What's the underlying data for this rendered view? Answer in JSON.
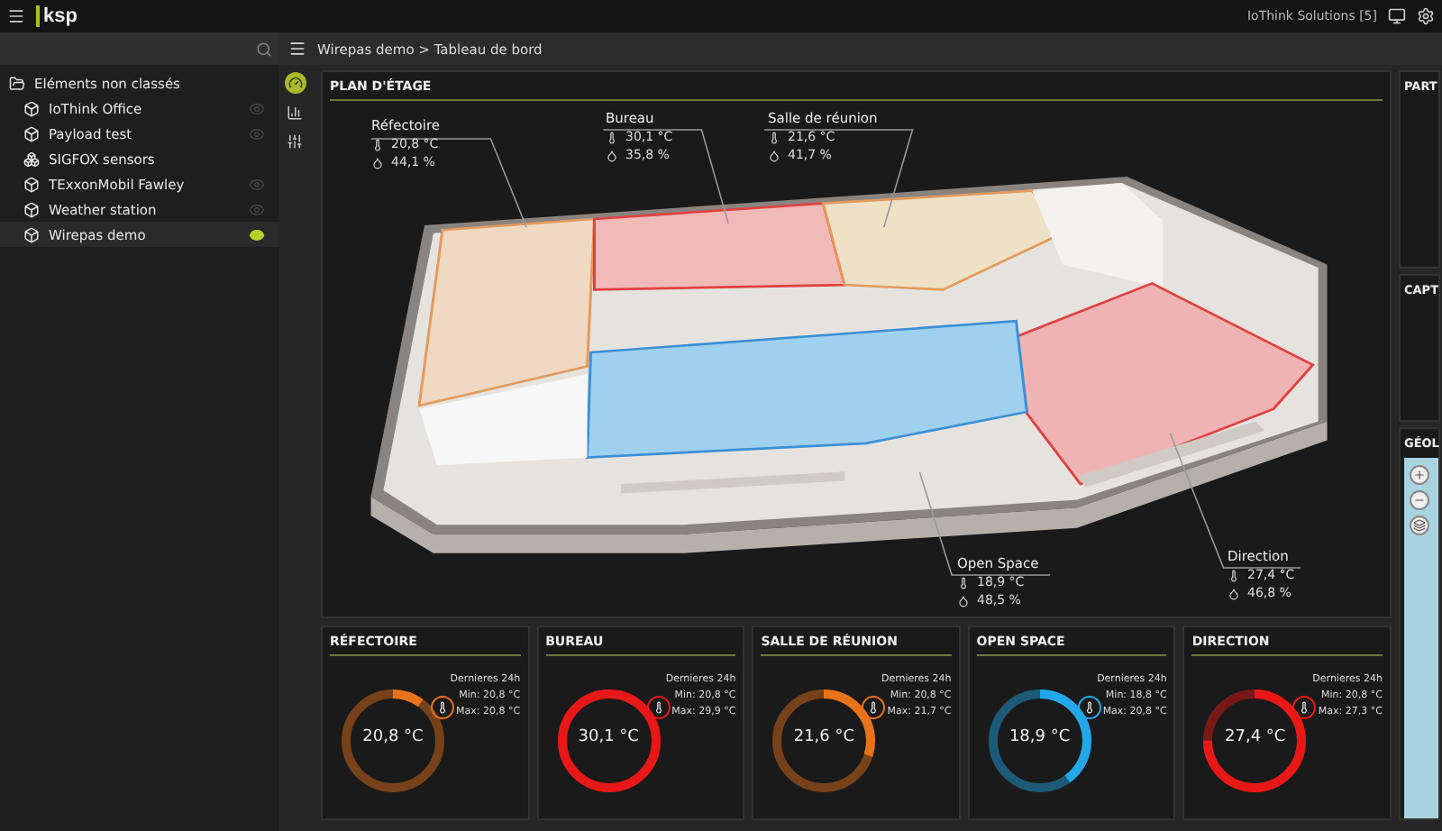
{
  "topbar": {
    "logo": "ksp",
    "account": "IoThink Solutions [5]"
  },
  "sidebar": {
    "tree": [
      {
        "label": "Eléments non classés",
        "kind": "folder",
        "children": [
          {
            "label": "IoThink Office",
            "kind": "device",
            "selected": false
          },
          {
            "label": "Payload test",
            "kind": "device",
            "selected": false
          },
          {
            "label": "SIGFOX sensors",
            "kind": "group",
            "selected": false
          },
          {
            "label": "TExxonMobil Fawley",
            "kind": "device",
            "selected": false
          },
          {
            "label": "Weather station",
            "kind": "device",
            "selected": false
          },
          {
            "label": "Wirepas demo",
            "kind": "device",
            "selected": true
          }
        ]
      }
    ]
  },
  "tools": [
    {
      "kind": "dashboard",
      "selected": true
    },
    {
      "kind": "chart",
      "selected": false
    },
    {
      "kind": "settings",
      "selected": false
    }
  ],
  "breadcrumb": "Wirepas demo > Tableau de bord",
  "floor_plan": {
    "title": "PLAN D'ÉTAGE",
    "rooms": [
      {
        "name": "Réfectoire",
        "temperature": "20,8 °C",
        "humidity": "44,1 %"
      },
      {
        "name": "Bureau",
        "temperature": "30,1 °C",
        "humidity": "35,8 %"
      },
      {
        "name": "Salle de réunion",
        "temperature": "21,6 °C",
        "humidity": "41,7 %"
      },
      {
        "name": "Open Space",
        "temperature": "18,9 °C",
        "humidity": "48,5 %"
      },
      {
        "name": "Direction",
        "temperature": "27,4 °C",
        "humidity": "46,8 %"
      }
    ]
  },
  "gauges": [
    {
      "title": "RÉFECTOIRE",
      "value": "20,8 °C",
      "level": 0.1,
      "color": "#e8731a",
      "period": "Dernieres 24h",
      "min": "Min: 20,8 °C",
      "max": "Max: 20,8 °C"
    },
    {
      "title": "BUREAU",
      "value": "30,1 °C",
      "level": 1,
      "color": "#e81818",
      "period": "Dernieres 24h",
      "min": "Min: 20,8 °C",
      "max": "Max: 29,9 °C"
    },
    {
      "title": "SALLE DE RÉUNION",
      "value": "21,6 °C",
      "level": 0.3,
      "color": "#e8731a",
      "period": "Dernieres 24h",
      "min": "Min: 20,8 °C",
      "max": "Max: 21,7 °C"
    },
    {
      "title": "OPEN SPACE",
      "value": "18,9 °C",
      "level": 0.4,
      "color": "#22a8e8",
      "period": "Dernieres 24h",
      "min": "Min: 18,8 °C",
      "max": "Max: 20,8 °C"
    },
    {
      "title": "DIRECTION",
      "value": "27,4 °C",
      "level": 0.75,
      "color": "#e81818",
      "period": "Dernieres 24h",
      "min": "Min: 20,8 °C",
      "max": "Max: 27,3 °C"
    }
  ],
  "right_panels": [
    {
      "title": "PART"
    },
    {
      "title": "CAPT"
    },
    {
      "title": "GÉOL"
    }
  ]
}
